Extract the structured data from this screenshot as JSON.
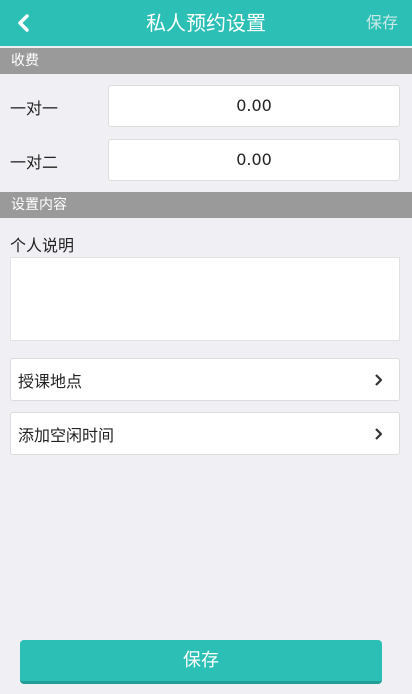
{
  "header": {
    "title": "私人预约设置",
    "save_label": "保存"
  },
  "sections": {
    "fee": "收费",
    "content": "设置内容"
  },
  "pricing": [
    {
      "label": "一对一",
      "value": "0.00"
    },
    {
      "label": "一对二",
      "value": "0.00"
    }
  ],
  "content": {
    "description_label": "个人说明",
    "description_value": "",
    "items": [
      {
        "label": "授课地点"
      },
      {
        "label": "添加空闲时间"
      }
    ]
  },
  "footer": {
    "save_label": "保存"
  },
  "colors": {
    "accent": "#2bbfb6",
    "section_bg": "#9a9a9a",
    "page_bg": "#f0eff4"
  }
}
